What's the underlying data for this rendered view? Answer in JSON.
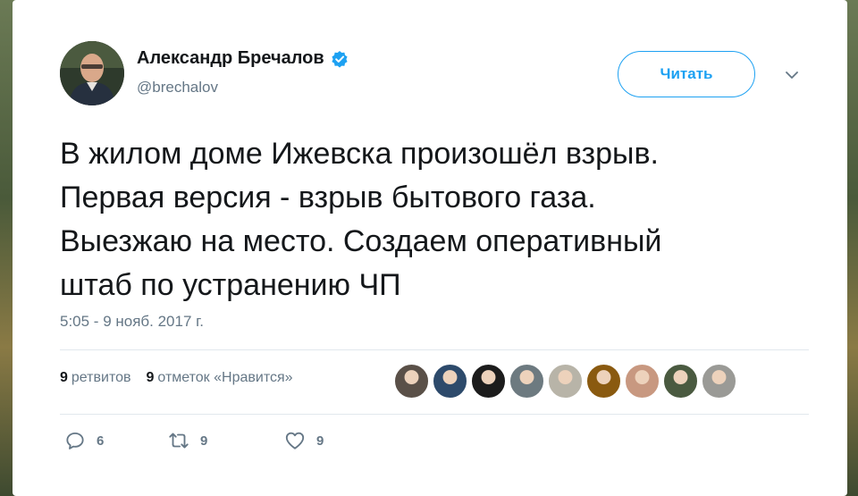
{
  "tweet": {
    "author_name": "Александр Бречалов",
    "handle": "@brechalov",
    "follow_label": "Читать",
    "text": "В жилом доме Ижевска произошёл взрыв.\nПервая версия - взрыв бытового газа.\nВыезжаю на место. Создаем оперативный\nштаб по устранению ЧП",
    "timestamp": "5:05 - 9 нояб. 2017 г."
  },
  "stats": {
    "retweets_count": "9",
    "retweets_label": "ретвитов",
    "likes_count": "9",
    "likes_label": "отметок «Нравится»"
  },
  "likers": [
    {
      "color": "#5a5048"
    },
    {
      "color": "#2d4a6b"
    },
    {
      "color": "#1c1c1c"
    },
    {
      "color": "#6d7a80"
    },
    {
      "color": "#b8b4a8"
    },
    {
      "color": "#8a5a10"
    },
    {
      "color": "#c89880"
    },
    {
      "color": "#4a5a40"
    },
    {
      "color": "#9a9a96"
    }
  ],
  "actions": {
    "reply_count": "6",
    "retweet_count": "9",
    "like_count": "9"
  },
  "colors": {
    "accent": "#1da1f2",
    "text_primary": "#14171a",
    "text_secondary": "#657786"
  }
}
